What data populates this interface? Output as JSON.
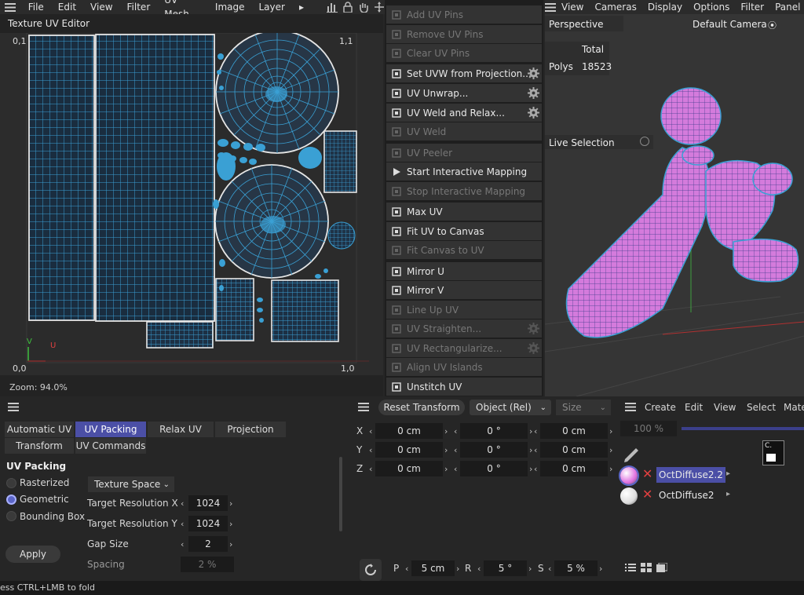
{
  "main_menu": {
    "items": [
      "File",
      "Edit",
      "View",
      "Filter",
      "UV Mesh",
      "Image",
      "Layer"
    ],
    "more": "▸"
  },
  "uv_editor": {
    "title": "Texture UV Editor",
    "corner_tl": "0,1",
    "corner_tr": "1,1",
    "corner_bl": "0,0",
    "corner_br": "1,0",
    "axis_v": "V",
    "axis_u": "U",
    "zoom": "Zoom: 94.0%"
  },
  "uv_commands": [
    {
      "label": "Add UV Pins",
      "enabled": false,
      "icon": "pin-icon"
    },
    {
      "label": "Remove UV Pins",
      "enabled": false,
      "icon": "pin-remove-icon"
    },
    {
      "label": "Clear UV Pins",
      "enabled": false,
      "icon": "clear-icon"
    },
    {
      "label": "Set UVW from Projection...",
      "enabled": true,
      "icon": "projection-icon",
      "gear": true
    },
    {
      "label": "UV Unwrap...",
      "enabled": true,
      "icon": "unwrap-icon",
      "gear": true
    },
    {
      "label": "UV Weld and Relax...",
      "enabled": true,
      "icon": "weld-relax-icon",
      "gear": true
    },
    {
      "label": "UV Weld",
      "enabled": false,
      "icon": "weld-icon"
    },
    {
      "label": "UV Peeler",
      "enabled": false,
      "icon": "peeler-icon"
    },
    {
      "label": "Start Interactive Mapping",
      "enabled": true,
      "icon": "play-icon"
    },
    {
      "label": "Stop Interactive Mapping",
      "enabled": false,
      "icon": "stop-icon"
    },
    {
      "label": "Max UV",
      "enabled": true,
      "icon": "max-uv-icon"
    },
    {
      "label": "Fit UV to Canvas",
      "enabled": true,
      "icon": "fit-canvas-icon"
    },
    {
      "label": "Fit Canvas to UV",
      "enabled": false,
      "icon": "fit-uv-icon"
    },
    {
      "label": "Mirror U",
      "enabled": true,
      "icon": "mirror-u-icon"
    },
    {
      "label": "Mirror V",
      "enabled": true,
      "icon": "mirror-v-icon"
    },
    {
      "label": "Line Up UV",
      "enabled": false,
      "icon": "line-up-icon"
    },
    {
      "label": "UV Straighten...",
      "enabled": false,
      "icon": "straighten-icon",
      "gear": true
    },
    {
      "label": "UV Rectangularize...",
      "enabled": false,
      "icon": "rectangularize-icon",
      "gear": true
    },
    {
      "label": "Align UV Islands",
      "enabled": false,
      "icon": "align-icon"
    },
    {
      "label": "Unstitch UV",
      "enabled": true,
      "icon": "unstitch-icon"
    }
  ],
  "viewport": {
    "menu": [
      "View",
      "Cameras",
      "Display",
      "Options",
      "Filter",
      "Panel"
    ],
    "name": "Perspective",
    "camera": "Default Camera",
    "camera_icon": "⦿",
    "total_label": "Total",
    "polys_label": "Polys",
    "polys_value": "18523",
    "live_selection": "Live Selection"
  },
  "uv_tabs": {
    "tabs": [
      "Automatic UV",
      "UV Packing",
      "Relax UV",
      "Projection",
      "Transform",
      "UV Commands"
    ],
    "active": "UV Packing",
    "section_title": "UV Packing",
    "methods": [
      "Rasterized",
      "Geometric",
      "Bounding Box"
    ],
    "selected_method": "Geometric",
    "space": "Texture Space",
    "target_res_x_label": "Target Resolution X",
    "target_res_x": "1024",
    "target_res_y_label": "Target Resolution Y",
    "target_res_y": "1024",
    "gap_label": "Gap Size",
    "gap": "2",
    "spacing_label": "Spacing",
    "spacing": "2 %",
    "apply": "Apply"
  },
  "coords": {
    "reset": "Reset Transform",
    "mode": "Object (Rel)",
    "size_mode": "Size",
    "rows": [
      {
        "axis": "X",
        "pos": "0 cm",
        "rot": "0 °",
        "size": "0 cm"
      },
      {
        "axis": "Y",
        "pos": "0 cm",
        "rot": "0 °",
        "size": "0 cm"
      },
      {
        "axis": "Z",
        "pos": "0 cm",
        "rot": "0 °",
        "size": "0 cm"
      }
    ],
    "p_label": "P",
    "p_value": "5 cm",
    "r_label": "R",
    "r_value": "5 °",
    "s_label": "S",
    "s_value": "5 %"
  },
  "materials": {
    "menu": [
      "Create",
      "Edit",
      "View",
      "Select",
      "Mate"
    ],
    "percent": "100 %",
    "items": [
      {
        "name": "OctDiffuse2.2",
        "selected": true,
        "color": "#e070e0"
      },
      {
        "name": "OctDiffuse2",
        "selected": false,
        "color": "#dddddd"
      }
    ],
    "c_badge": "C."
  },
  "status": "ess CTRL+LMB to fold",
  "colors": {
    "accent": "#4b4fa6",
    "uv_blue": "#3aa0d4",
    "mesh_pink": "#d47bdc"
  }
}
